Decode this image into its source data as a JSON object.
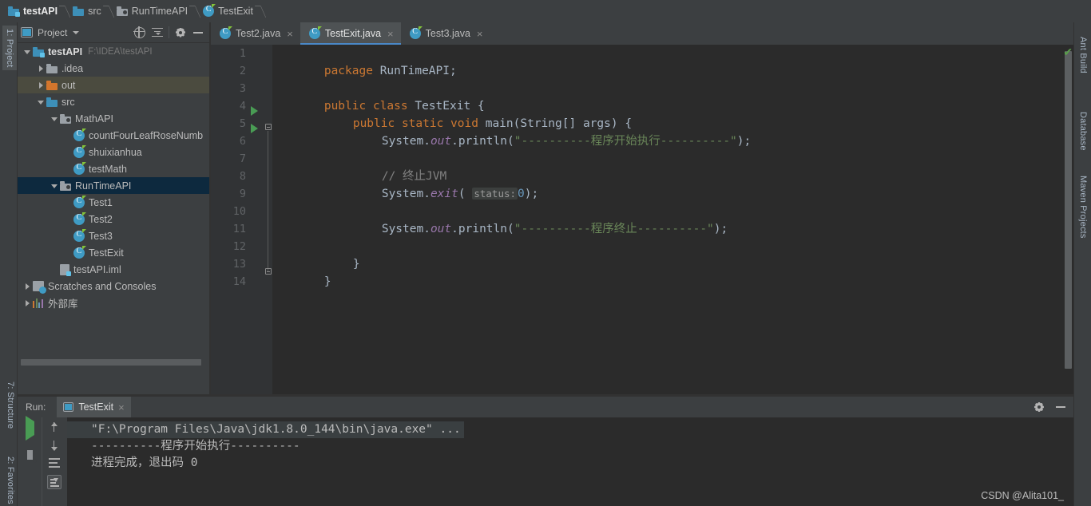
{
  "breadcrumb": [
    {
      "label": "testAPI",
      "icon": "module-folder-icon"
    },
    {
      "label": "src",
      "icon": "source-folder-icon"
    },
    {
      "label": "RunTimeAPI",
      "icon": "package-icon"
    },
    {
      "label": "TestExit",
      "icon": "java-class-icon"
    }
  ],
  "left_strip": {
    "project_tab": "1: Project",
    "structure_tab": "7: Structure",
    "favorites_tab": "2: Favorites"
  },
  "right_strip": {
    "ant_build": "Ant Build",
    "database": "Database",
    "maven_projects": "Maven Projects"
  },
  "project_panel": {
    "title": "Project",
    "toolbar": [
      "locate-icon",
      "collapse-all-icon",
      "settings-gear-icon",
      "hide-icon"
    ],
    "tree": [
      {
        "label": "testAPI",
        "path": "F:\\IDEA\\testAPI",
        "icon": "module-folder-icon",
        "twist": "down",
        "indent": 0,
        "bold": true,
        "state": "none"
      },
      {
        "label": ".idea",
        "path": "",
        "icon": "folder-gray-icon",
        "twist": "right",
        "indent": 1,
        "bold": false,
        "state": "none"
      },
      {
        "label": "out",
        "path": "",
        "icon": "folder-orange-icon",
        "twist": "right",
        "indent": 1,
        "bold": false,
        "state": "selected-unfocused"
      },
      {
        "label": "src",
        "path": "",
        "icon": "folder-blue-icon",
        "twist": "down",
        "indent": 1,
        "bold": false,
        "state": "none"
      },
      {
        "label": "MathAPI",
        "path": "",
        "icon": "package-icon",
        "twist": "down",
        "indent": 2,
        "bold": false,
        "state": "none"
      },
      {
        "label": "countFourLeafRoseNumb",
        "path": "",
        "icon": "java-class-icon",
        "twist": "none",
        "indent": 3,
        "bold": false,
        "state": "none"
      },
      {
        "label": "shuixianhua",
        "path": "",
        "icon": "java-class-icon",
        "twist": "none",
        "indent": 3,
        "bold": false,
        "state": "none"
      },
      {
        "label": "testMath",
        "path": "",
        "icon": "java-class-icon",
        "twist": "none",
        "indent": 3,
        "bold": false,
        "state": "none"
      },
      {
        "label": "RunTimeAPI",
        "path": "",
        "icon": "package-icon",
        "twist": "down",
        "indent": 2,
        "bold": false,
        "state": "selected-focused"
      },
      {
        "label": "Test1",
        "path": "",
        "icon": "java-class-icon",
        "twist": "none",
        "indent": 3,
        "bold": false,
        "state": "none"
      },
      {
        "label": "Test2",
        "path": "",
        "icon": "java-class-icon",
        "twist": "none",
        "indent": 3,
        "bold": false,
        "state": "none"
      },
      {
        "label": "Test3",
        "path": "",
        "icon": "java-class-icon",
        "twist": "none",
        "indent": 3,
        "bold": false,
        "state": "none"
      },
      {
        "label": "TestExit",
        "path": "",
        "icon": "java-class-icon",
        "twist": "none",
        "indent": 3,
        "bold": false,
        "state": "none"
      },
      {
        "label": "testAPI.iml",
        "path": "",
        "icon": "iml-file-icon",
        "twist": "none",
        "indent": 2,
        "bold": false,
        "state": "none"
      },
      {
        "label": "Scratches and Consoles",
        "path": "",
        "icon": "scratches-icon",
        "twist": "right",
        "indent": 0,
        "bold": false,
        "state": "none"
      },
      {
        "label": "外部库",
        "path": "",
        "icon": "external-libraries-icon",
        "twist": "right",
        "indent": 0,
        "bold": false,
        "state": "none"
      }
    ]
  },
  "editor": {
    "tabs": [
      {
        "label": "Test2.java",
        "active": false
      },
      {
        "label": "TestExit.java",
        "active": true
      },
      {
        "label": "Test3.java",
        "active": false
      }
    ],
    "close_glyph": "×",
    "inspection_status": "✔",
    "line_numbers": [
      "1",
      "2",
      "3",
      "4",
      "5",
      "6",
      "7",
      "8",
      "9",
      "10",
      "11",
      "12",
      "13",
      "14"
    ],
    "code": {
      "l1_package_kw": "package",
      "l1_package_name": "RunTimeAPI;",
      "l3_public": "public",
      "l3_class": "class",
      "l3_name": "TestExit {",
      "l4_mods": "public static void",
      "l4_main": "main",
      "l4_params": "(String[] args) {",
      "l5_expr": "System.",
      "l5_out": "out",
      "l5_call": ".println(",
      "l5_string": "\"----------程序开始执行----------\"",
      "l5_end": ");",
      "l7_comment": "// 终止JVM",
      "l8_expr": "System.",
      "l8_exit": "exit",
      "l8_open": "( ",
      "l8_hint": "status:",
      "l8_value": "0",
      "l8_end": ");",
      "l10_expr": "System.",
      "l10_out": "out",
      "l10_call": ".println(",
      "l10_string": "\"----------程序终止----------\"",
      "l10_end": ");",
      "l12_brace": "}",
      "l13_brace": "}"
    }
  },
  "run_panel": {
    "run_label": "Run:",
    "tab_label": "TestExit",
    "close_glyph": "×",
    "toolbar_left": [
      "rerun-play-icon",
      "stop-icon",
      "pause-icon",
      "camera-icon"
    ],
    "toolbar_right": [
      "up-arrow-icon",
      "down-arrow-icon",
      "soft-wrap-icon",
      "scroll-to-end-icon"
    ],
    "header_icons": [
      "settings-gear-icon",
      "hide-icon"
    ],
    "console_lines": [
      "\"F:\\Program Files\\Java\\jdk1.8.0_144\\bin\\java.exe\" ...",
      "----------程序开始执行----------",
      "",
      "进程完成，退出码 0"
    ]
  },
  "watermark": "CSDN @Alita101_",
  "colors": {
    "editor_bg": "#2b2b2b",
    "panel_bg": "#3c3f41",
    "gutter_bg": "#313335",
    "keyword": "#cc7832",
    "string": "#6a8759",
    "field": "#9876aa",
    "number": "#6897bb",
    "comment": "#808080",
    "text": "#a9b7c6",
    "selection_focused": "#0d293e",
    "selection_unfocused": "#4b4b3f",
    "tab_underline": "#4a88c7",
    "run_green": "#499c54"
  }
}
